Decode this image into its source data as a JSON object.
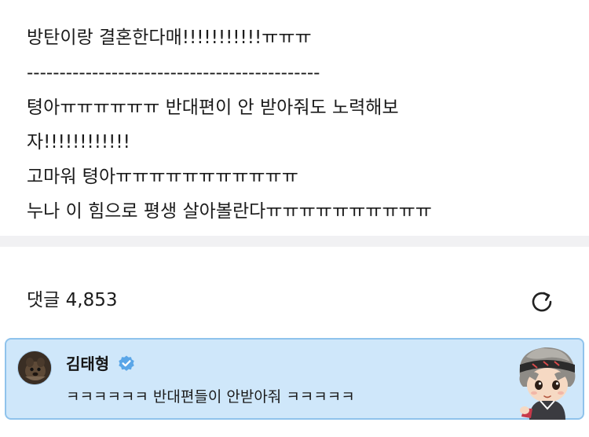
{
  "post": {
    "lines": [
      "방탄이랑 결혼한다매!!!!!!!!!!!ㅠㅠㅠ",
      "---------------------------------------------",
      "텽아ㅠㅠㅠㅠㅠㅠ 반대편이 안 받아줘도 노력해보",
      "자!!!!!!!!!!!!",
      "고마워 텽아ㅠㅠㅠㅠㅠㅠㅠㅠㅠㅠㅠ",
      "누나 이 힘으로 평생 살아볼란다ㅠㅠㅠㅠㅠㅠㅠㅠㅠㅠ"
    ]
  },
  "comments": {
    "count_label": "댓글 4,853",
    "refresh_icon": "refresh-icon"
  },
  "highlighted_comment": {
    "author": "김태형",
    "verified_icon": "verified-badge-icon",
    "text": "ㅋㅋㅋㅋㅋㅋ 반대편들이 안받아줘 ㅋㅋㅋㅋㅋ",
    "sticker": "character-sticker",
    "background_color": "#cfe7fa",
    "border_color": "#8fc3ec",
    "badge_color": "#5aa6e8"
  }
}
